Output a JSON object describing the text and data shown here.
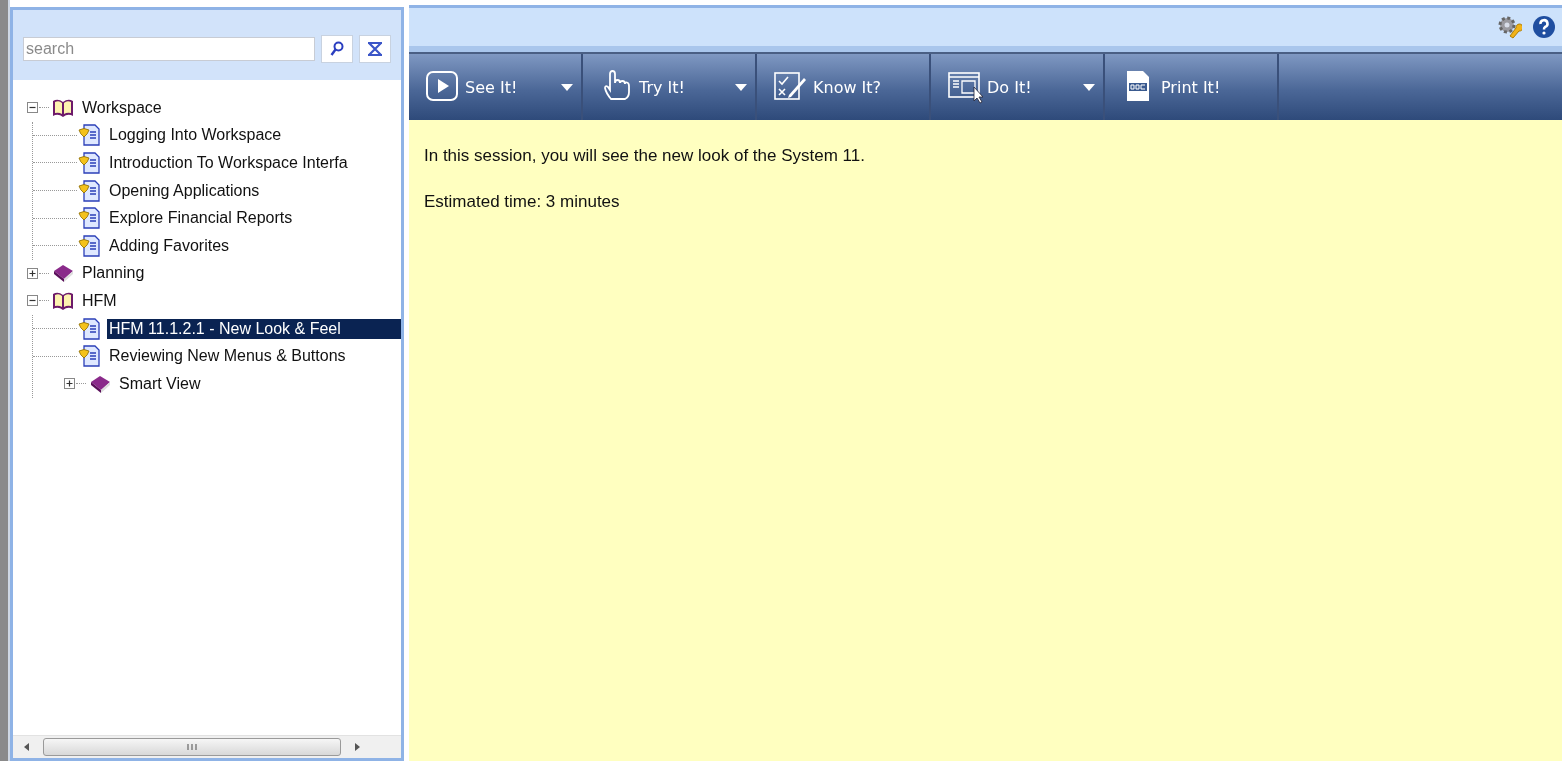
{
  "search": {
    "placeholder": "search"
  },
  "tree": [
    {
      "label": "Workspace",
      "kind": "book",
      "expanded": true,
      "selected": false,
      "children": [
        {
          "label": "Logging Into Workspace",
          "kind": "topic",
          "selected": false
        },
        {
          "label": "Introduction To Workspace Interfa",
          "kind": "topic",
          "selected": false
        },
        {
          "label": "Opening Applications",
          "kind": "topic",
          "selected": false
        },
        {
          "label": "Explore Financial Reports",
          "kind": "topic",
          "selected": false
        },
        {
          "label": "Adding Favorites",
          "kind": "topic",
          "selected": false
        }
      ]
    },
    {
      "label": "Planning",
      "kind": "book",
      "expanded": false,
      "selected": false
    },
    {
      "label": "HFM",
      "kind": "book",
      "expanded": true,
      "selected": false,
      "children": [
        {
          "label": "HFM 11.1.2.1 - New Look & Feel",
          "kind": "topic",
          "selected": true
        },
        {
          "label": "Reviewing New Menus & Buttons",
          "kind": "topic",
          "selected": false
        },
        {
          "label": "Smart View",
          "kind": "book",
          "expanded": false,
          "selected": false
        }
      ]
    }
  ],
  "toolbar": [
    {
      "label": "See It!",
      "kind": "play",
      "has_menu": true
    },
    {
      "label": "Try It!",
      "kind": "hand",
      "has_menu": true
    },
    {
      "label": "Know It?",
      "kind": "check",
      "has_menu": false
    },
    {
      "label": "Do It!",
      "kind": "screen",
      "has_menu": true
    },
    {
      "label": "Print It!",
      "kind": "doc",
      "has_menu": false
    }
  ],
  "content": {
    "paragraphs": [
      "In this session, you will see the new look of the System 11.",
      "Estimated time: 3 minutes"
    ]
  }
}
